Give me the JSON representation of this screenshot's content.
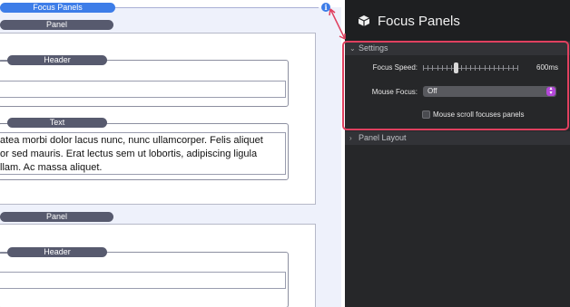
{
  "canvas": {
    "root_label": "Focus Panels",
    "panel1": {
      "label": "Panel",
      "header_label": "Header",
      "text_label": "Text",
      "text_lines": [
        "atea morbi dolor lacus nunc, nunc ullamcorper. Felis aliquet",
        "or sed mauris. Erat lectus sem ut lobortis, adipiscing ligula",
        "llam. Ac massa aliquet."
      ]
    },
    "panel2": {
      "label": "Panel",
      "header_label": "Header"
    }
  },
  "inspector": {
    "title": "Focus Panels",
    "settings_section": "Settings",
    "focus_speed_label": "Focus Speed:",
    "focus_speed_value": "600ms",
    "focus_speed_slider_fraction": 0.35,
    "mouse_focus_label": "Mouse Focus:",
    "mouse_focus_value": "Off",
    "scroll_checkbox_label": "Mouse scroll focuses panels",
    "scroll_checkbox_checked": false,
    "panel_layout_section": "Panel Layout"
  },
  "icons": {
    "info": "info-icon",
    "cube": "cube-icon",
    "chevron_down": "chevron-down-icon",
    "chevron_right": "chevron-right-icon"
  },
  "colors": {
    "highlight": "#e0405f",
    "accent_blue": "#3d7de8",
    "select_accent": "#b347d9"
  }
}
